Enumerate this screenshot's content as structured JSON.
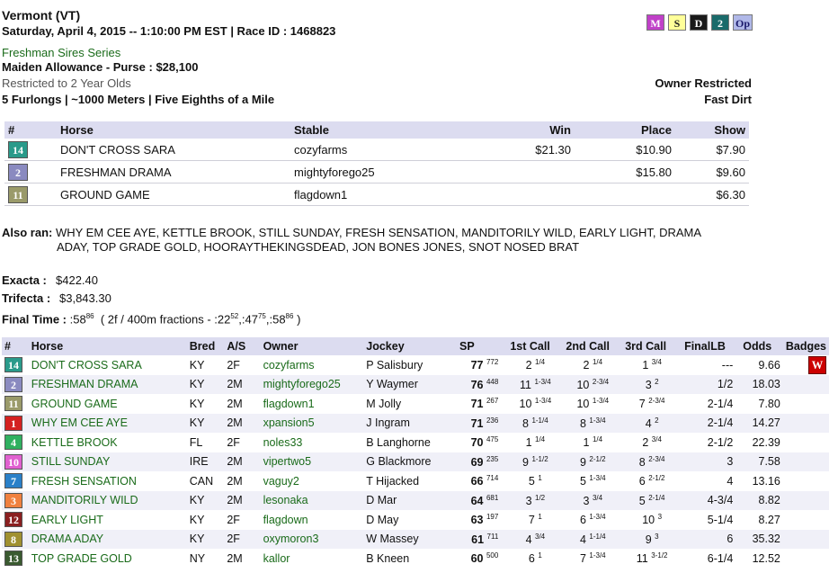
{
  "header": {
    "track": "Vermont (VT)",
    "date_line": "Saturday, April 4, 2015 -- 1:10:00 PM EST | Race ID : 1468823",
    "series": "Freshman Sires Series",
    "race_type": "Maiden Allowance - Purse : $28,100",
    "restriction": "Restricted to 2 Year Olds",
    "distance": "5 Furlongs | ~1000 Meters | Five Eighths of a Mile",
    "owner_restricted": "Owner Restricted",
    "surface": "Fast Dirt"
  },
  "tags": [
    {
      "label": "M",
      "bg": "#c040c8",
      "fg": "#ffffff"
    },
    {
      "label": "S",
      "bg": "#ffff99",
      "fg": "#222222"
    },
    {
      "label": "D",
      "bg": "#1a1a1a",
      "fg": "#ffffff"
    },
    {
      "label": "2",
      "bg": "#1a6b6b",
      "fg": "#ffffff"
    },
    {
      "label": "Op",
      "bg": "#b0b8e8",
      "fg": "#1a1a6b"
    }
  ],
  "payouts": {
    "headers": {
      "num": "#",
      "horse": "Horse",
      "stable": "Stable",
      "win": "Win",
      "place": "Place",
      "show": "Show"
    },
    "rows": [
      {
        "num": "14",
        "horse": "DON'T CROSS SARA",
        "stable": "cozyfarms",
        "win": "$21.30",
        "place": "$10.90",
        "show": "$7.90",
        "bg": "#2a9a8a"
      },
      {
        "num": "2",
        "horse": "FRESHMAN DRAMA",
        "stable": "mightyforego25",
        "win": "",
        "place": "$15.80",
        "show": "$9.60",
        "bg": "#8a8ac0"
      },
      {
        "num": "11",
        "horse": "GROUND GAME",
        "stable": "flagdown1",
        "win": "",
        "place": "",
        "show": "$6.30",
        "bg": "#9a9a6a"
      }
    ]
  },
  "also_ran": {
    "label": "Also ran:",
    "line1": "WHY EM CEE AYE, KETTLE BROOK, STILL SUNDAY, FRESH SENSATION, MANDITORILY WILD, EARLY LIGHT, DRAMA",
    "line2": "ADAY, TOP GRADE GOLD, HOORAYTHEKINGSDEAD, JON BONES JONES, SNOT NOSED BRAT"
  },
  "exotics": {
    "exacta_label": "Exacta :",
    "exacta_value": "$422.40",
    "trifecta_label": "Trifecta :",
    "trifecta_value": "$3,843.30"
  },
  "final_time": {
    "label": "Final Time :",
    "time": ":58",
    "time_sup": "86",
    "fractions_prefix": "( 2f / 400m fractions - :22",
    "f1_sup": "52",
    "f2": ",:47",
    "f2_sup": "75",
    "f3": ",:58",
    "f3_sup": "86",
    "suffix": ")"
  },
  "results": {
    "headers": {
      "num": "#",
      "horse": "Horse",
      "bred": "Bred",
      "as": "A/S",
      "owner": "Owner",
      "jockey": "Jockey",
      "sp": "SP",
      "c1": "1st Call",
      "c2": "2nd Call",
      "c3": "3rd Call",
      "lb": "FinalLB",
      "odds": "Odds",
      "badges": "Badges"
    },
    "rows": [
      {
        "num": "14",
        "bg": "#2a9a8a",
        "fg": "#ffffff",
        "horse": "DON'T CROSS SARA",
        "bred": "KY",
        "as": "2F",
        "owner": "cozyfarms",
        "jockey": "P Salisbury",
        "sp": "77",
        "sp_sup": "772",
        "c1": "2",
        "c1s": "1/4",
        "c2": "2",
        "c2s": "1/4",
        "c3": "1",
        "c3s": "3/4",
        "lb": "---",
        "odds": "9.66",
        "badge": "W"
      },
      {
        "num": "2",
        "bg": "#8a8ac0",
        "fg": "#ffffff",
        "horse": "FRESHMAN DRAMA",
        "bred": "KY",
        "as": "2M",
        "owner": "mightyforego25",
        "jockey": "Y Waymer",
        "sp": "76",
        "sp_sup": "448",
        "c1": "11",
        "c1s": "1-3/4",
        "c2": "10",
        "c2s": "2-3/4",
        "c3": "3",
        "c3s": "2",
        "lb": "1/2",
        "odds": "18.03",
        "badge": ""
      },
      {
        "num": "11",
        "bg": "#9a9a6a",
        "fg": "#ffffff",
        "horse": "GROUND GAME",
        "bred": "KY",
        "as": "2M",
        "owner": "flagdown1",
        "jockey": "M Jolly",
        "sp": "71",
        "sp_sup": "267",
        "c1": "10",
        "c1s": "1-3/4",
        "c2": "10",
        "c2s": "1-3/4",
        "c3": "7",
        "c3s": "2-3/4",
        "lb": "2-1/4",
        "odds": "7.80",
        "badge": ""
      },
      {
        "num": "1",
        "bg": "#d42020",
        "fg": "#ffffff",
        "horse": "WHY EM CEE AYE",
        "bred": "KY",
        "as": "2M",
        "owner": "xpansion5",
        "jockey": "J Ingram",
        "sp": "71",
        "sp_sup": "236",
        "c1": "8",
        "c1s": "1-1/4",
        "c2": "8",
        "c2s": "1-3/4",
        "c3": "4",
        "c3s": "2",
        "lb": "2-1/4",
        "odds": "14.27",
        "badge": ""
      },
      {
        "num": "4",
        "bg": "#30b060",
        "fg": "#ffffff",
        "horse": "KETTLE BROOK",
        "bred": "FL",
        "as": "2F",
        "owner": "noles33",
        "jockey": "B Langhorne",
        "sp": "70",
        "sp_sup": "475",
        "c1": "1",
        "c1s": "1/4",
        "c2": "1",
        "c2s": "1/4",
        "c3": "2",
        "c3s": "3/4",
        "lb": "2-1/2",
        "odds": "22.39",
        "badge": ""
      },
      {
        "num": "10",
        "bg": "#e060d0",
        "fg": "#ffffff",
        "horse": "STILL SUNDAY",
        "bred": "IRE",
        "as": "2M",
        "owner": "vipertwo5",
        "jockey": "G Blackmore",
        "sp": "69",
        "sp_sup": "235",
        "c1": "9",
        "c1s": "1-1/2",
        "c2": "9",
        "c2s": "2-1/2",
        "c3": "8",
        "c3s": "2-3/4",
        "lb": "3",
        "odds": "7.58",
        "badge": ""
      },
      {
        "num": "7",
        "bg": "#2a80c8",
        "fg": "#ffffff",
        "horse": "FRESH SENSATION",
        "bred": "CAN",
        "as": "2M",
        "owner": "vaguy2",
        "jockey": "T Hijacked",
        "sp": "66",
        "sp_sup": "714",
        "c1": "5",
        "c1s": "1",
        "c2": "5",
        "c2s": "1-3/4",
        "c3": "6",
        "c3s": "2-1/2",
        "lb": "4",
        "odds": "13.16",
        "badge": ""
      },
      {
        "num": "3",
        "bg": "#f08040",
        "fg": "#ffffff",
        "horse": "MANDITORILY WILD",
        "bred": "KY",
        "as": "2M",
        "owner": "lesonaka",
        "jockey": "D Mar",
        "sp": "64",
        "sp_sup": "681",
        "c1": "3",
        "c1s": "1/2",
        "c2": "3",
        "c2s": "3/4",
        "c3": "5",
        "c3s": "2-1/4",
        "lb": "4-3/4",
        "odds": "8.82",
        "badge": ""
      },
      {
        "num": "12",
        "bg": "#8a2020",
        "fg": "#ffffff",
        "horse": "EARLY LIGHT",
        "bred": "KY",
        "as": "2F",
        "owner": "flagdown",
        "jockey": "D May",
        "sp": "63",
        "sp_sup": "197",
        "c1": "7",
        "c1s": "1",
        "c2": "6",
        "c2s": "1-3/4",
        "c3": "10",
        "c3s": "3",
        "lb": "5-1/4",
        "odds": "8.27",
        "badge": ""
      },
      {
        "num": "8",
        "bg": "#a09030",
        "fg": "#ffffff",
        "horse": "DRAMA ADAY",
        "bred": "KY",
        "as": "2F",
        "owner": "oxymoron3",
        "jockey": "W Massey",
        "sp": "61",
        "sp_sup": "711",
        "c1": "4",
        "c1s": "3/4",
        "c2": "4",
        "c2s": "1-1/4",
        "c3": "9",
        "c3s": "3",
        "lb": "6",
        "odds": "35.32",
        "badge": ""
      },
      {
        "num": "13",
        "bg": "#3a5a30",
        "fg": "#ffffff",
        "horse": "TOP GRADE GOLD",
        "bred": "NY",
        "as": "2M",
        "owner": "kallor",
        "jockey": "B Kneen",
        "sp": "60",
        "sp_sup": "500",
        "c1": "6",
        "c1s": "1",
        "c2": "7",
        "c2s": "1-3/4",
        "c3": "11",
        "c3s": "3-1/2",
        "lb": "6-1/4",
        "odds": "12.52",
        "badge": ""
      }
    ]
  }
}
